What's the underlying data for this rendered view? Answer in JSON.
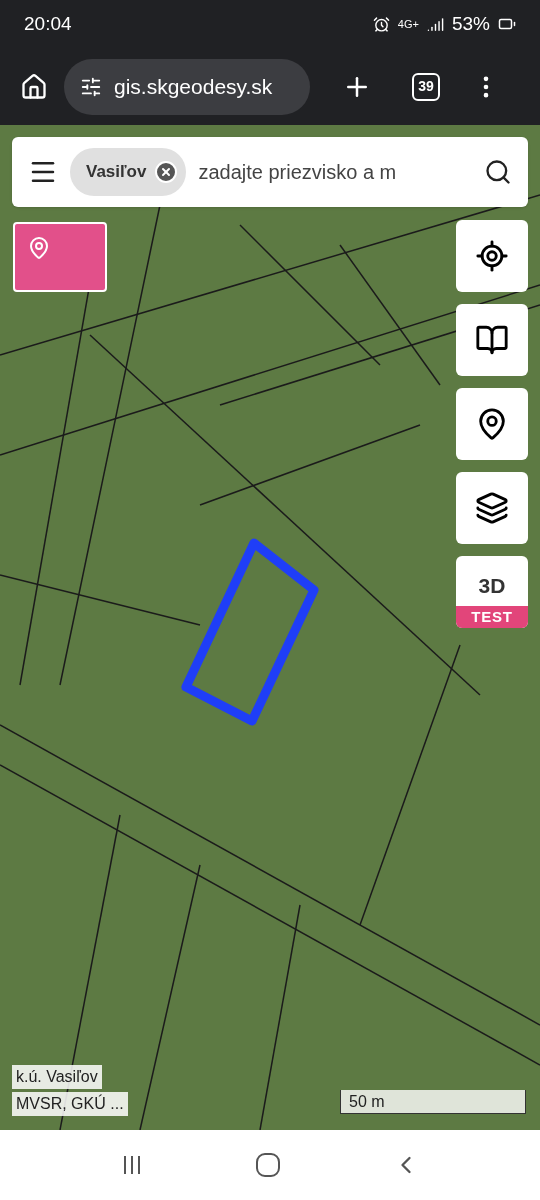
{
  "status_bar": {
    "time": "20:04",
    "network": "4G+",
    "battery": "53%"
  },
  "browser": {
    "url": "gis.skgeodesy.sk",
    "tab_count": "39"
  },
  "search": {
    "chip": "Vasiľov",
    "placeholder": "zadajte priezvisko a m"
  },
  "map_tools": {
    "mode_button": {
      "label": "3D",
      "badge": "TEST"
    }
  },
  "attribution": [
    "k.ú. Vasiľov",
    "MVSR, GKÚ ..."
  ],
  "scale": "50 m"
}
